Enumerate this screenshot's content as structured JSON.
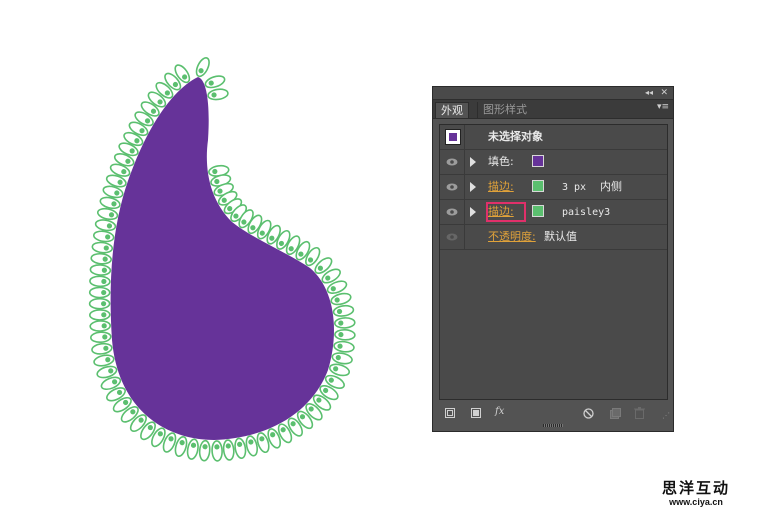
{
  "panel": {
    "collapse_icon": "double-arrow-icon",
    "close_icon": "close-icon",
    "tabs": [
      {
        "label": "外观",
        "active": true
      },
      {
        "label": "图形样式",
        "active": false
      }
    ],
    "menu_icon": "panel-menu-icon"
  },
  "appearance": {
    "header": {
      "label": "未选择对象",
      "thumbnail_color": "#663399"
    },
    "fill": {
      "label": "填色:",
      "color": "#663399"
    },
    "stroke1": {
      "label": "描边:",
      "color": "#5bbf6f",
      "weight": "3 px",
      "align": "内侧"
    },
    "stroke2": {
      "label": "描边:",
      "color": "#5bbf6f",
      "brush": "paisley3"
    },
    "opacity": {
      "label": "不透明度:",
      "value": "默认值"
    }
  },
  "bottom_icons": [
    "add-stroke-icon",
    "add-fill-icon",
    "fx-icon",
    "clear-icon",
    "duplicate-icon",
    "delete-icon"
  ],
  "fx_label": "fx",
  "watermark": {
    "title": "思洋互动",
    "url": "www.ciya.cn"
  },
  "colors": {
    "shape_fill": "#663399",
    "pattern_stroke": "#5bbf6f",
    "panel_bg": "#535353"
  }
}
